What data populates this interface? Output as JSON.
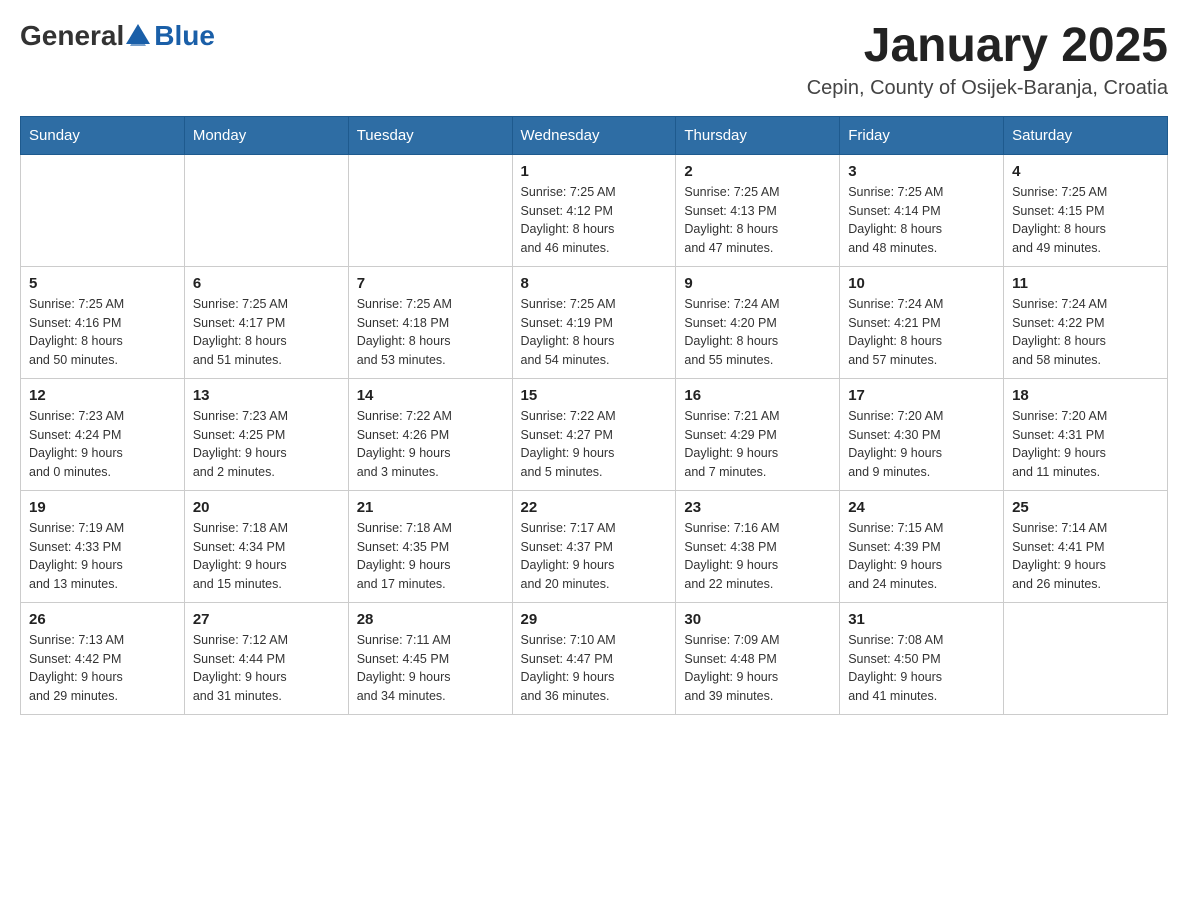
{
  "logo": {
    "text_general": "General",
    "text_blue": "Blue"
  },
  "header": {
    "title": "January 2025",
    "subtitle": "Cepin, County of Osijek-Baranja, Croatia"
  },
  "weekdays": [
    "Sunday",
    "Monday",
    "Tuesday",
    "Wednesday",
    "Thursday",
    "Friday",
    "Saturday"
  ],
  "weeks": [
    [
      {
        "day": "",
        "info": ""
      },
      {
        "day": "",
        "info": ""
      },
      {
        "day": "",
        "info": ""
      },
      {
        "day": "1",
        "info": "Sunrise: 7:25 AM\nSunset: 4:12 PM\nDaylight: 8 hours\nand 46 minutes."
      },
      {
        "day": "2",
        "info": "Sunrise: 7:25 AM\nSunset: 4:13 PM\nDaylight: 8 hours\nand 47 minutes."
      },
      {
        "day": "3",
        "info": "Sunrise: 7:25 AM\nSunset: 4:14 PM\nDaylight: 8 hours\nand 48 minutes."
      },
      {
        "day": "4",
        "info": "Sunrise: 7:25 AM\nSunset: 4:15 PM\nDaylight: 8 hours\nand 49 minutes."
      }
    ],
    [
      {
        "day": "5",
        "info": "Sunrise: 7:25 AM\nSunset: 4:16 PM\nDaylight: 8 hours\nand 50 minutes."
      },
      {
        "day": "6",
        "info": "Sunrise: 7:25 AM\nSunset: 4:17 PM\nDaylight: 8 hours\nand 51 minutes."
      },
      {
        "day": "7",
        "info": "Sunrise: 7:25 AM\nSunset: 4:18 PM\nDaylight: 8 hours\nand 53 minutes."
      },
      {
        "day": "8",
        "info": "Sunrise: 7:25 AM\nSunset: 4:19 PM\nDaylight: 8 hours\nand 54 minutes."
      },
      {
        "day": "9",
        "info": "Sunrise: 7:24 AM\nSunset: 4:20 PM\nDaylight: 8 hours\nand 55 minutes."
      },
      {
        "day": "10",
        "info": "Sunrise: 7:24 AM\nSunset: 4:21 PM\nDaylight: 8 hours\nand 57 minutes."
      },
      {
        "day": "11",
        "info": "Sunrise: 7:24 AM\nSunset: 4:22 PM\nDaylight: 8 hours\nand 58 minutes."
      }
    ],
    [
      {
        "day": "12",
        "info": "Sunrise: 7:23 AM\nSunset: 4:24 PM\nDaylight: 9 hours\nand 0 minutes."
      },
      {
        "day": "13",
        "info": "Sunrise: 7:23 AM\nSunset: 4:25 PM\nDaylight: 9 hours\nand 2 minutes."
      },
      {
        "day": "14",
        "info": "Sunrise: 7:22 AM\nSunset: 4:26 PM\nDaylight: 9 hours\nand 3 minutes."
      },
      {
        "day": "15",
        "info": "Sunrise: 7:22 AM\nSunset: 4:27 PM\nDaylight: 9 hours\nand 5 minutes."
      },
      {
        "day": "16",
        "info": "Sunrise: 7:21 AM\nSunset: 4:29 PM\nDaylight: 9 hours\nand 7 minutes."
      },
      {
        "day": "17",
        "info": "Sunrise: 7:20 AM\nSunset: 4:30 PM\nDaylight: 9 hours\nand 9 minutes."
      },
      {
        "day": "18",
        "info": "Sunrise: 7:20 AM\nSunset: 4:31 PM\nDaylight: 9 hours\nand 11 minutes."
      }
    ],
    [
      {
        "day": "19",
        "info": "Sunrise: 7:19 AM\nSunset: 4:33 PM\nDaylight: 9 hours\nand 13 minutes."
      },
      {
        "day": "20",
        "info": "Sunrise: 7:18 AM\nSunset: 4:34 PM\nDaylight: 9 hours\nand 15 minutes."
      },
      {
        "day": "21",
        "info": "Sunrise: 7:18 AM\nSunset: 4:35 PM\nDaylight: 9 hours\nand 17 minutes."
      },
      {
        "day": "22",
        "info": "Sunrise: 7:17 AM\nSunset: 4:37 PM\nDaylight: 9 hours\nand 20 minutes."
      },
      {
        "day": "23",
        "info": "Sunrise: 7:16 AM\nSunset: 4:38 PM\nDaylight: 9 hours\nand 22 minutes."
      },
      {
        "day": "24",
        "info": "Sunrise: 7:15 AM\nSunset: 4:39 PM\nDaylight: 9 hours\nand 24 minutes."
      },
      {
        "day": "25",
        "info": "Sunrise: 7:14 AM\nSunset: 4:41 PM\nDaylight: 9 hours\nand 26 minutes."
      }
    ],
    [
      {
        "day": "26",
        "info": "Sunrise: 7:13 AM\nSunset: 4:42 PM\nDaylight: 9 hours\nand 29 minutes."
      },
      {
        "day": "27",
        "info": "Sunrise: 7:12 AM\nSunset: 4:44 PM\nDaylight: 9 hours\nand 31 minutes."
      },
      {
        "day": "28",
        "info": "Sunrise: 7:11 AM\nSunset: 4:45 PM\nDaylight: 9 hours\nand 34 minutes."
      },
      {
        "day": "29",
        "info": "Sunrise: 7:10 AM\nSunset: 4:47 PM\nDaylight: 9 hours\nand 36 minutes."
      },
      {
        "day": "30",
        "info": "Sunrise: 7:09 AM\nSunset: 4:48 PM\nDaylight: 9 hours\nand 39 minutes."
      },
      {
        "day": "31",
        "info": "Sunrise: 7:08 AM\nSunset: 4:50 PM\nDaylight: 9 hours\nand 41 minutes."
      },
      {
        "day": "",
        "info": ""
      }
    ]
  ]
}
